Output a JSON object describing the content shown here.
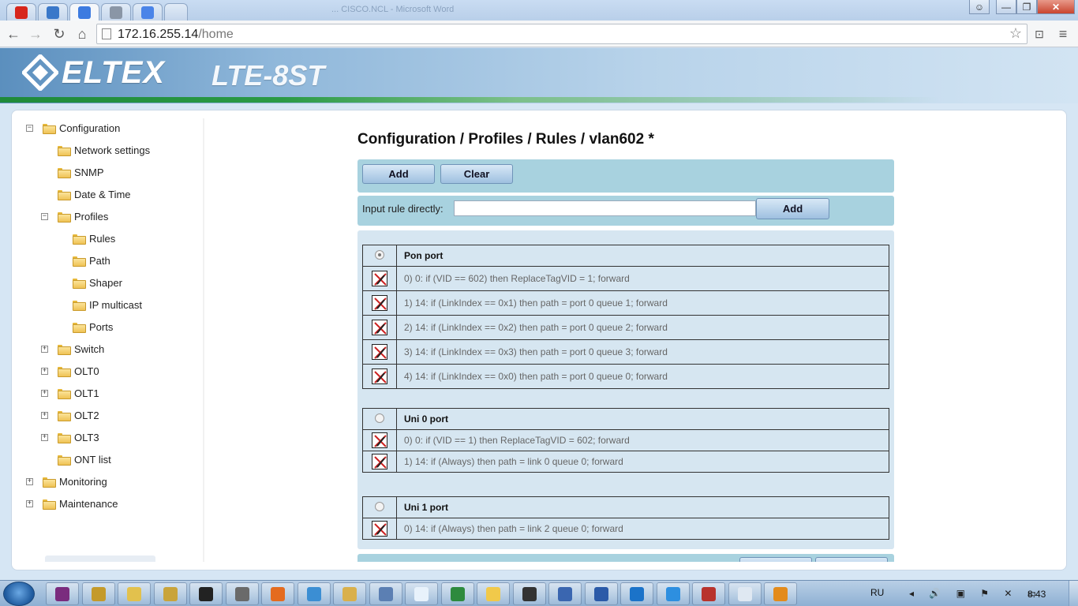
{
  "browser": {
    "tabs": [
      {
        "icon": "youtube-icon",
        "color": "#d7261c"
      },
      {
        "icon": "chrome-logo-icon",
        "color": "#3a78c9"
      },
      {
        "icon": "google-icon",
        "color": "#3d7be0",
        "active": true
      },
      {
        "icon": "blank-page-icon",
        "color": "#8a96a6"
      },
      {
        "icon": "translate-icon",
        "color": "#4a84e8"
      },
      {
        "icon": "new-tab-icon",
        "color": "#c6d7ec"
      }
    ],
    "window_title": "... CISCO.NCL - Microsoft Word",
    "url_host": "172.16.255.14",
    "url_path": "/home"
  },
  "header": {
    "brand": "ELTEX",
    "model": "LTE-8ST"
  },
  "tree": [
    {
      "label": "Configuration",
      "level": 0,
      "toggle": "−",
      "id": "configuration"
    },
    {
      "label": "Network settings",
      "level": 1,
      "toggle": "",
      "id": "network-settings"
    },
    {
      "label": "SNMP",
      "level": 1,
      "toggle": "",
      "id": "snmp"
    },
    {
      "label": "Date & Time",
      "level": 1,
      "toggle": "",
      "id": "date-time"
    },
    {
      "label": "Profiles",
      "level": 1,
      "toggle": "−",
      "id": "profiles"
    },
    {
      "label": "Rules",
      "level": 2,
      "toggle": "",
      "id": "rules"
    },
    {
      "label": "Path",
      "level": 2,
      "toggle": "",
      "id": "path"
    },
    {
      "label": "Shaper",
      "level": 2,
      "toggle": "",
      "id": "shaper"
    },
    {
      "label": "IP multicast",
      "level": 2,
      "toggle": "",
      "id": "ip-multicast"
    },
    {
      "label": "Ports",
      "level": 2,
      "toggle": "",
      "id": "ports"
    },
    {
      "label": "Switch",
      "level": 1,
      "toggle": "+",
      "id": "switch"
    },
    {
      "label": "OLT0",
      "level": 1,
      "toggle": "+",
      "id": "olt0"
    },
    {
      "label": "OLT1",
      "level": 1,
      "toggle": "+",
      "id": "olt1"
    },
    {
      "label": "OLT2",
      "level": 1,
      "toggle": "+",
      "id": "olt2"
    },
    {
      "label": "OLT3",
      "level": 1,
      "toggle": "+",
      "id": "olt3"
    },
    {
      "label": "ONT list",
      "level": 1,
      "toggle": "",
      "id": "ont-list"
    },
    {
      "label": "Monitoring",
      "level": 0,
      "toggle": "+",
      "id": "monitoring"
    },
    {
      "label": "Maintenance",
      "level": 0,
      "toggle": "+",
      "id": "maintenance"
    }
  ],
  "main": {
    "title": "Configuration / Profiles / Rules / vlan602 *",
    "add_label": "Add",
    "clear_label": "Clear",
    "input_label": "Input rule directly:",
    "input_value": "",
    "input_add_label": "Add"
  },
  "groups": [
    {
      "name": "Pon port",
      "selected": true,
      "rules": [
        "0) 0: if (VID == 602) then ReplaceTagVID = 1; forward",
        "1) 14: if (LinkIndex == 0x1) then path = port 0 queue 1; forward",
        "2) 14: if (LinkIndex == 0x2) then path = port 0 queue 2; forward",
        "3) 14: if (LinkIndex == 0x3) then path = port 0 queue 3; forward",
        "4) 14: if (LinkIndex == 0x0) then path = port 0 queue 0; forward"
      ]
    },
    {
      "name": "Uni 0 port",
      "selected": false,
      "rules": [
        "0) 0: if (VID == 1) then ReplaceTagVID = 602; forward",
        "1) 14: if (Always) then path = link 0 queue 0; forward"
      ]
    },
    {
      "name": "Uni 1 port",
      "selected": false,
      "rules": [
        "0) 14: if (Always) then path = link 2 queue 0; forward"
      ]
    }
  ],
  "taskbar": {
    "apps": [
      "winrar-icon",
      "network-icon",
      "explorer-icon",
      "archive-icon",
      "cmd-icon",
      "server-icon",
      "firefox-icon",
      "chrome-icon",
      "tool-icon",
      "search-tool-icon",
      "notepad-icon",
      "excel-icon",
      "smile-icon",
      "calc-icon",
      "remote-icon",
      "word-icon",
      "teamviewer-icon",
      "ie-icon",
      "shield-app-icon",
      "files-icon",
      "chat-icon"
    ],
    "app_colors": [
      "#7a2c7e",
      "#c49a2a",
      "#e2c14d",
      "#c9a43b",
      "#222",
      "#6a6a6a",
      "#e46b1f",
      "#3b8ed3",
      "#d9b04c",
      "#5b7fb3",
      "#e8f2fb",
      "#2d8a3e",
      "#f1c94a",
      "#333",
      "#3a66b0",
      "#2b5aa8",
      "#1b73c9",
      "#2d8fe0",
      "#b8332c",
      "#dfe8f2",
      "#e38b1c"
    ],
    "language": "RU",
    "tray": "◂ 🔊 ▣ ⚑ ✕ ▭",
    "clock": "8:43"
  },
  "colors": {
    "panel": "#a8d2df",
    "rules_area": "#d6e6f1",
    "button": "#9ec0e0"
  }
}
